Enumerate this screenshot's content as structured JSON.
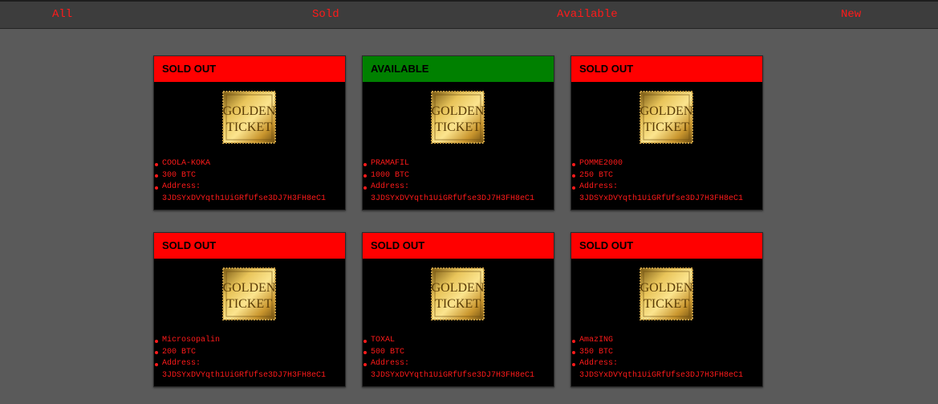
{
  "nav": {
    "items": [
      {
        "label": "All"
      },
      {
        "label": "Sold"
      },
      {
        "label": "Available"
      },
      {
        "label": "New"
      }
    ]
  },
  "colors": {
    "sold": "#ff0000",
    "available": "#008000",
    "text_accent": "#ff1a1a",
    "background": "#5a5a5a",
    "nav_background": "#3d3d3d"
  },
  "ticket_image": {
    "line1": "GOLDEN",
    "line2": "TICKET",
    "icon": "golden-ticket-icon"
  },
  "cards": [
    {
      "status": "SOLD OUT",
      "status_key": "sold",
      "name": "COOLA-KOKA",
      "price": "300 BTC",
      "address_label": "Address:",
      "address": "3JDSYxDVYqth1UiGRfUfse3DJ7H3FH8eC1"
    },
    {
      "status": "AVAILABLE",
      "status_key": "available",
      "name": "PRAMAFIL",
      "price": "1000 BTC",
      "address_label": "Address:",
      "address": "3JDSYxDVYqth1UiGRfUfse3DJ7H3FH8eC1"
    },
    {
      "status": "SOLD OUT",
      "status_key": "sold",
      "name": "POMME2000",
      "price": "250 BTC",
      "address_label": "Address:",
      "address": "3JDSYxDVYqth1UiGRfUfse3DJ7H3FH8eC1"
    },
    {
      "status": "SOLD OUT",
      "status_key": "sold",
      "name": "Microsopalin",
      "price": "200 BTC",
      "address_label": "Address:",
      "address": "3JDSYxDVYqth1UiGRfUfse3DJ7H3FH8eC1"
    },
    {
      "status": "SOLD OUT",
      "status_key": "sold",
      "name": "TOXAL",
      "price": "500 BTC",
      "address_label": "Address:",
      "address": "3JDSYxDVYqth1UiGRfUfse3DJ7H3FH8eC1"
    },
    {
      "status": "SOLD OUT",
      "status_key": "sold",
      "name": "AmazING",
      "price": "350 BTC",
      "address_label": "Address:",
      "address": "3JDSYxDVYqth1UiGRfUfse3DJ7H3FH8eC1"
    }
  ]
}
